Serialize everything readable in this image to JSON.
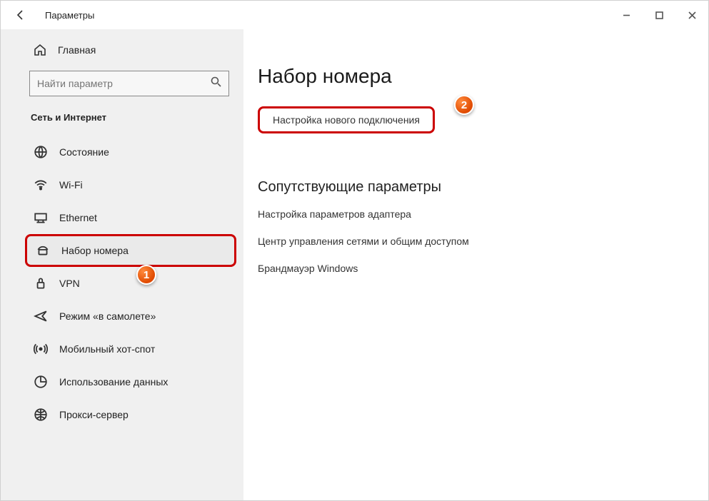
{
  "window": {
    "title": "Параметры"
  },
  "sidebar": {
    "home": "Главная",
    "search_placeholder": "Найти параметр",
    "category": "Сеть и Интернет",
    "items": [
      {
        "id": "status",
        "label": "Состояние"
      },
      {
        "id": "wifi",
        "label": "Wi-Fi"
      },
      {
        "id": "ethernet",
        "label": "Ethernet"
      },
      {
        "id": "dialup",
        "label": "Набор номера"
      },
      {
        "id": "vpn",
        "label": "VPN"
      },
      {
        "id": "airplane",
        "label": "Режим «в самолете»"
      },
      {
        "id": "hotspot",
        "label": "Мобильный хот-спот"
      },
      {
        "id": "datausage",
        "label": "Использование данных"
      },
      {
        "id": "proxy",
        "label": "Прокси-сервер"
      }
    ]
  },
  "content": {
    "title": "Набор номера",
    "new_connection": "Настройка нового подключения",
    "related_title": "Сопутствующие параметры",
    "links": [
      "Настройка параметров адаптера",
      "Центр управления сетями и общим доступом",
      "Брандмауэр Windows"
    ]
  },
  "annotations": {
    "badge1": "1",
    "badge2": "2"
  }
}
